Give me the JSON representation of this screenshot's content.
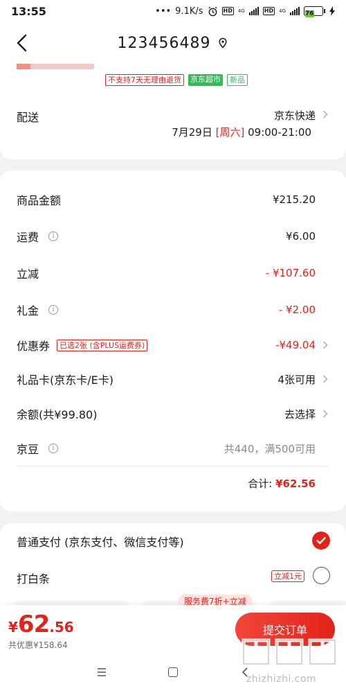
{
  "status_bar": {
    "time": "13:55",
    "dots": "•••",
    "speed": "9.1K/s",
    "hd1": "HD",
    "net1": "4G",
    "hd2": "HD",
    "net2": "4G",
    "battery": "76"
  },
  "header": {
    "title": "123456489",
    "back_icon": "chevron-left-icon",
    "location_icon": "location-pin-icon"
  },
  "product": {
    "tags": [
      "不支持7天无理由退货",
      "京东超市",
      "新品"
    ]
  },
  "shipping": {
    "label": "配送",
    "method": "京东快递",
    "date": "7月29日",
    "weekday": "[周六]",
    "time_window": "09:00-21:00"
  },
  "amounts": {
    "goods_label": "商品金额",
    "goods_value": "¥215.20",
    "freight_label": "运费",
    "freight_value": "¥6.00",
    "discount_label": "立减",
    "discount_value": "- ¥107.60",
    "gift_money_label": "礼金",
    "gift_money_value": "- ¥2.00",
    "coupon_label": "优惠券",
    "coupon_tag": "已选2张 (含PLUS运费券)",
    "coupon_value": "-¥49.04",
    "gift_card_label": "礼品卡(京东卡/E卡)",
    "gift_card_value": "4张可用",
    "balance_label": "余额(共¥99.80)",
    "balance_value": "去选择",
    "jd_beans_label": "京豆",
    "jd_beans_value": "共440，满500可用",
    "total_label": "合计:",
    "total_value": "¥62.56"
  },
  "payment": {
    "normal_label": "普通支付 (京东支付、微信支付等)",
    "normal_selected": true,
    "baitiao_label": "打白条",
    "baitiao_tag": "立减1元",
    "service_badge": "服务费7折+立减"
  },
  "bottom_bar": {
    "currency": "¥",
    "price_int": "62",
    "price_dec": ".56",
    "saved": "共优惠¥158.64",
    "submit_label": "提交订单"
  },
  "watermark": {
    "text": "zhizhizhi.com"
  },
  "colors": {
    "accent": "#e2231a",
    "green": "#2fbd59",
    "background": "#f2f2f2"
  }
}
